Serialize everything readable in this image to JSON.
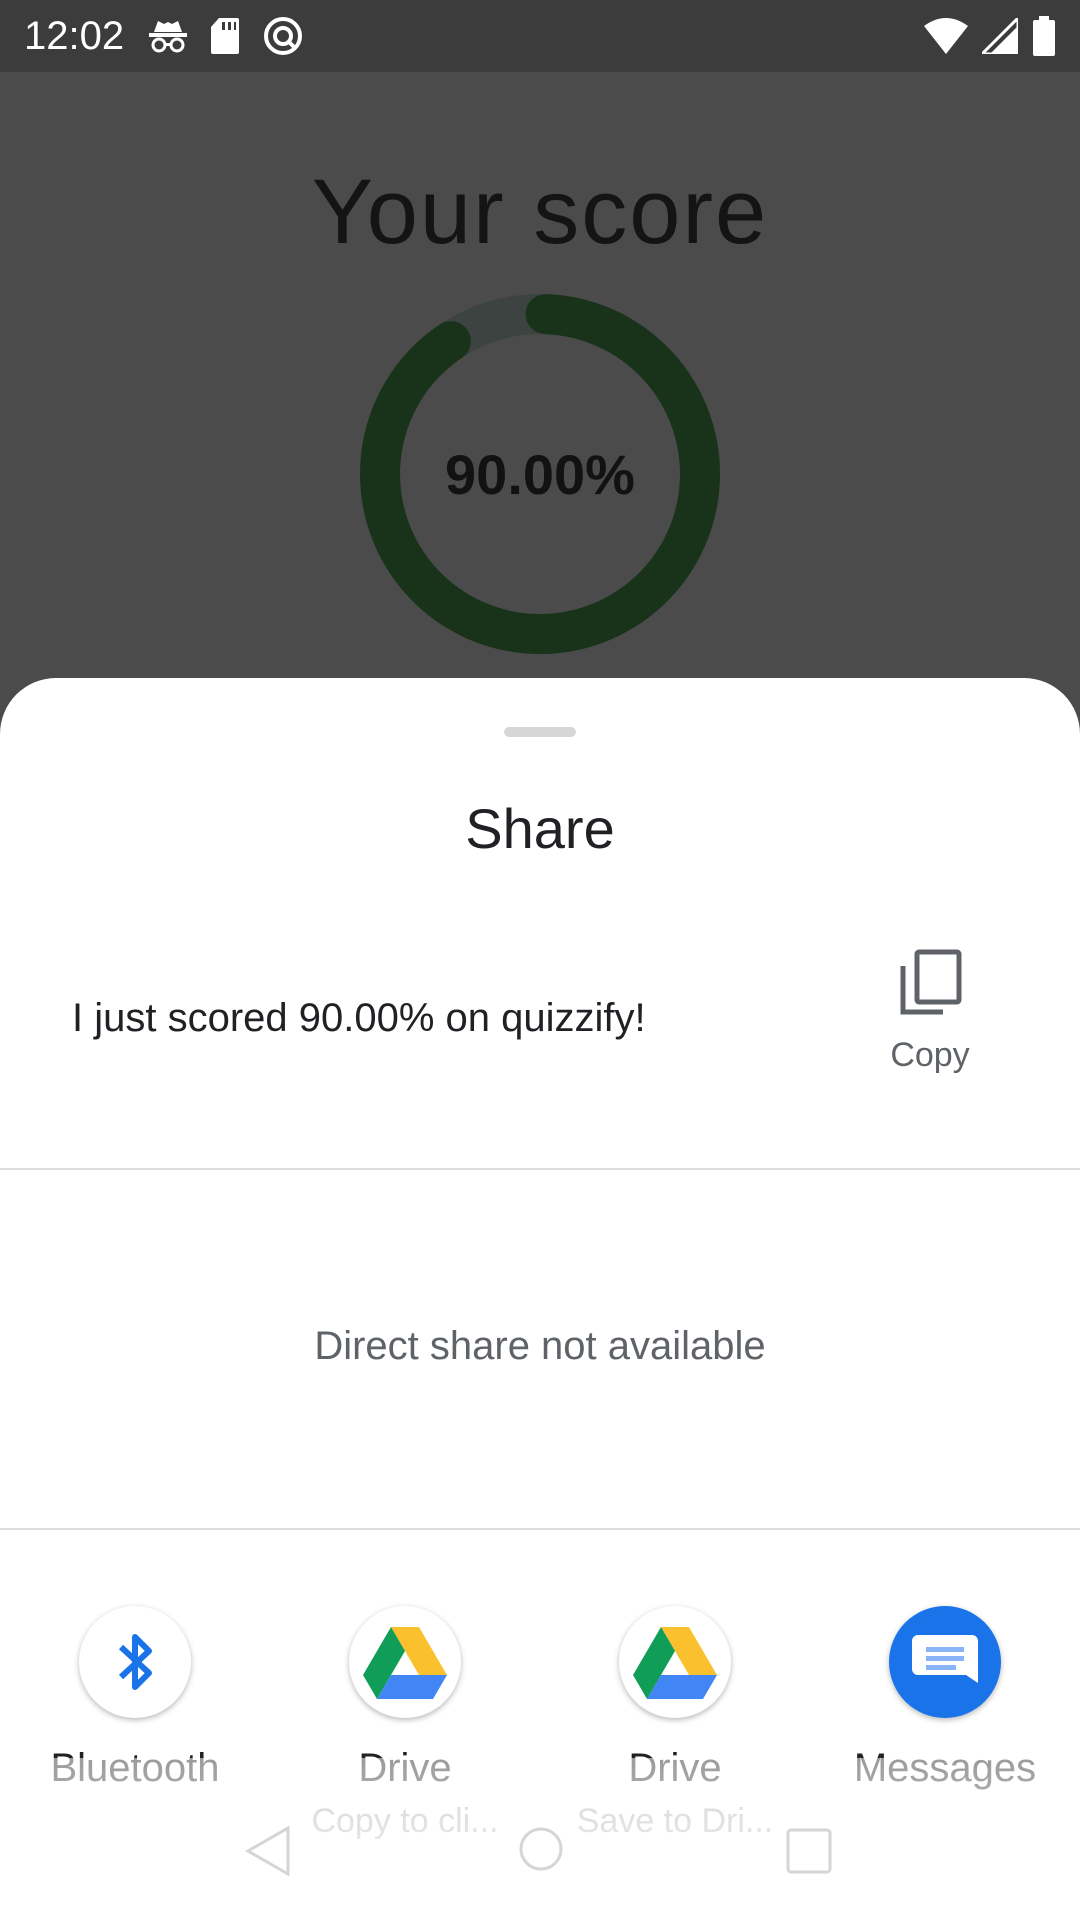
{
  "status_bar": {
    "time": "12:02",
    "left_icons": [
      "incognito-icon",
      "sd-card-icon",
      "data-saver-icon"
    ],
    "right_icons": [
      "wifi-icon",
      "cell-signal-icon",
      "battery-icon"
    ]
  },
  "background_app": {
    "title": "Your score",
    "score_text": "90.00%",
    "score_fraction": 0.9,
    "ring_color": "#18331a",
    "ring_track_color": "#3d4340"
  },
  "share_sheet": {
    "title": "Share",
    "share_text": "I just scored 90.00% on quizzify!",
    "copy_label": "Copy",
    "direct_share_message": "Direct share not available",
    "targets": [
      {
        "label": "Bluetooth",
        "sub": "",
        "icon": "bluetooth-icon"
      },
      {
        "label": "Drive",
        "sub": "Copy to cli...",
        "icon": "google-drive-icon"
      },
      {
        "label": "Drive",
        "sub": "Save to Dri...",
        "icon": "google-drive-icon"
      },
      {
        "label": "Messages",
        "sub": "",
        "icon": "messages-icon"
      }
    ]
  },
  "nav_bar": {
    "icons": [
      "back-icon",
      "home-icon",
      "recents-icon"
    ]
  }
}
